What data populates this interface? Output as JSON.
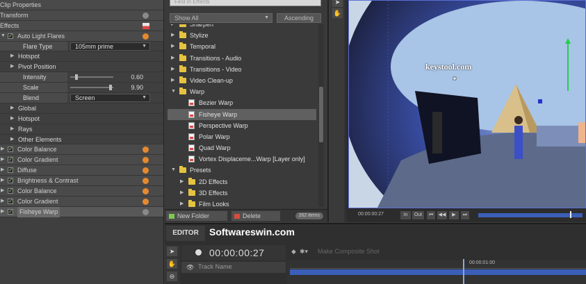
{
  "left_panel": {
    "title": "Clip Properties",
    "transform": "Transform",
    "effects": "Effects",
    "auto_light_flares": "Auto Light Flares",
    "flare_type_label": "Flare Type",
    "flare_type_value": "105mm prime",
    "hotspot1": "Hotspot",
    "pivot_position": "Pivot Position",
    "intensity_label": "Intensity",
    "intensity_value": "0.60",
    "intensity_fraction": 0.12,
    "scale_label": "Scale",
    "scale_value": "9.90",
    "scale_fraction": 0.97,
    "blend_label": "Blend",
    "blend_value": "Screen",
    "global": "Global",
    "hotspot2": "Hotspot",
    "rays": "Rays",
    "other_elements": "Other Elements",
    "effects_list": [
      "Color Balance",
      "Color Gradient",
      "Diffuse",
      "Brightness & Contrast",
      "Color Balance",
      "Color Gradient",
      "Fisheye Warp"
    ]
  },
  "effects_browser": {
    "search_placeholder": "Find in Effects",
    "filter": "Show All",
    "sort": "Ascending",
    "tree": [
      {
        "label": "Sharpen",
        "type": "folder",
        "level": 0,
        "expanded": false
      },
      {
        "label": "Stylize",
        "type": "folder",
        "level": 0,
        "expanded": false
      },
      {
        "label": "Temporal",
        "type": "folder",
        "level": 0,
        "expanded": false
      },
      {
        "label": "Transitions - Audio",
        "type": "folder",
        "level": 0,
        "expanded": false
      },
      {
        "label": "Transitions - Video",
        "type": "folder",
        "level": 0,
        "expanded": false
      },
      {
        "label": "Video Clean-up",
        "type": "folder",
        "level": 0,
        "expanded": false
      },
      {
        "label": "Warp",
        "type": "folder",
        "level": 0,
        "expanded": true
      },
      {
        "label": "Bezier Warp",
        "type": "effect",
        "level": 1
      },
      {
        "label": "Fisheye Warp",
        "type": "effect",
        "level": 1,
        "selected": true
      },
      {
        "label": "Perspective Warp",
        "type": "effect",
        "level": 1
      },
      {
        "label": "Polar Warp",
        "type": "effect",
        "level": 1
      },
      {
        "label": "Quad Warp",
        "type": "effect",
        "level": 1
      },
      {
        "label": "Vortex Displaceme...Warp [Layer only]",
        "type": "effect",
        "level": 1
      },
      {
        "label": "Presets",
        "type": "folder",
        "level": 0,
        "expanded": true
      },
      {
        "label": "2D Effects",
        "type": "folder",
        "level": 1,
        "expanded": false
      },
      {
        "label": "3D Effects",
        "type": "folder",
        "level": 1,
        "expanded": false
      },
      {
        "label": "Film Looks",
        "type": "folder",
        "level": 1,
        "expanded": false
      }
    ],
    "new_folder": "New Folder",
    "delete": "Delete",
    "item_count": "262 items"
  },
  "viewer": {
    "watermark": "keystool.com",
    "timecode": "00:00:00:27",
    "in_label": "In",
    "out_label": "Out",
    "colors": {
      "sky": "#c9d6e6",
      "sphere_dark": "#1b1f3a",
      "sphere_mid": "#3a4fa8",
      "pyramid": "#d9c08a",
      "road": "#5d6a8a"
    }
  },
  "editor": {
    "tab": "EDITOR",
    "watermark": "Softwareswin.com",
    "timecode": "00:00:00:27",
    "composite": "Make Composite Shot",
    "track_name": "Track Name",
    "ruler_label": "00:00:01:00",
    "accent": "#3b5fb8"
  }
}
